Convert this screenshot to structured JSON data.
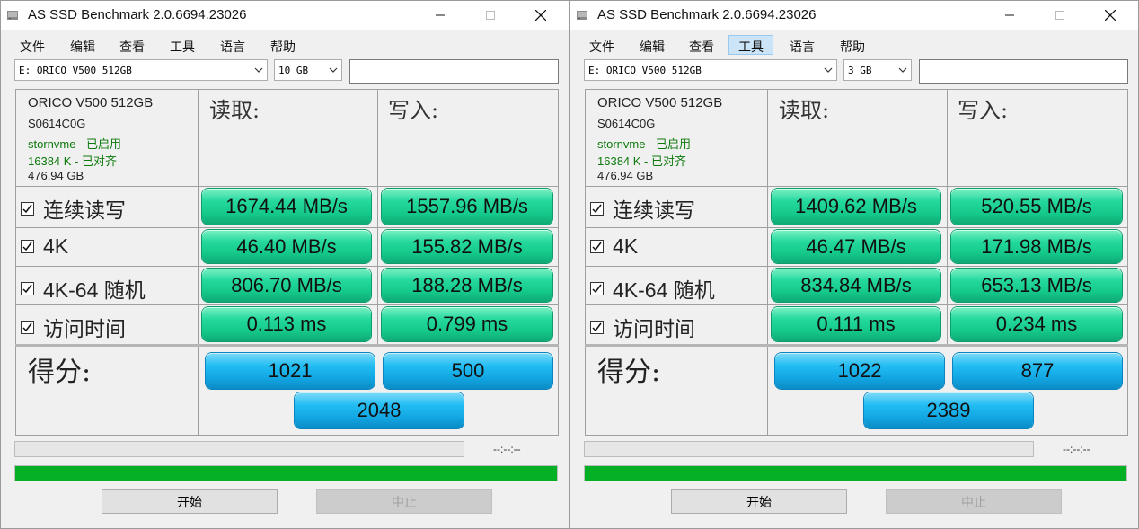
{
  "windows": [
    {
      "title": "AS SSD Benchmark 2.0.6694.23026",
      "menu": [
        "文件",
        "编辑",
        "查看",
        "工具",
        "语言",
        "帮助"
      ],
      "active_menu": -1,
      "drive_select": "E: ORICO V500 512GB",
      "size_select": "10 GB",
      "info": {
        "model": "ORICO V500 512GB",
        "firmware": "S0614C0G",
        "driver": "stornvme - 已启用",
        "alignment": "16384 K - 已对齐",
        "capacity": "476.94 GB"
      },
      "read_header": "读取:",
      "write_header": "写入:",
      "rows": [
        {
          "label": "连续读写",
          "read": "1674.44 MB/s",
          "write": "1557.96 MB/s"
        },
        {
          "label": "4K",
          "read": "46.40 MB/s",
          "write": "155.82 MB/s"
        },
        {
          "label": "4K-64 随机",
          "read": "806.70 MB/s",
          "write": "188.28 MB/s"
        },
        {
          "label": "访问时间",
          "read": "0.113 ms",
          "write": "0.799 ms"
        }
      ],
      "score_label": "得分:",
      "score_read": "1021",
      "score_write": "500",
      "score_total": "2048",
      "time": "--:--:--",
      "start_label": "开始",
      "stop_label": "中止"
    },
    {
      "title": "AS SSD Benchmark 2.0.6694.23026",
      "menu": [
        "文件",
        "编辑",
        "查看",
        "工具",
        "语言",
        "帮助"
      ],
      "active_menu": 3,
      "drive_select": "E: ORICO V500 512GB",
      "size_select": "3 GB",
      "info": {
        "model": "ORICO V500 512GB",
        "firmware": "S0614C0G",
        "driver": "stornvme - 已启用",
        "alignment": "16384 K - 已对齐",
        "capacity": "476.94 GB"
      },
      "read_header": "读取:",
      "write_header": "写入:",
      "rows": [
        {
          "label": "连续读写",
          "read": "1409.62 MB/s",
          "write": "520.55 MB/s"
        },
        {
          "label": "4K",
          "read": "46.47 MB/s",
          "write": "171.98 MB/s"
        },
        {
          "label": "4K-64 随机",
          "read": "834.84 MB/s",
          "write": "653.13 MB/s"
        },
        {
          "label": "访问时间",
          "read": "0.111 ms",
          "write": "0.234 ms"
        }
      ],
      "score_label": "得分:",
      "score_read": "1022",
      "score_write": "877",
      "score_total": "2389",
      "time": "--:--:--",
      "start_label": "开始",
      "stop_label": "中止"
    }
  ],
  "colors": {
    "progress_green": "#06b025",
    "result_green": "#14c98a",
    "score_blue": "#12a6e2",
    "status_green": "#0d7a0d"
  }
}
